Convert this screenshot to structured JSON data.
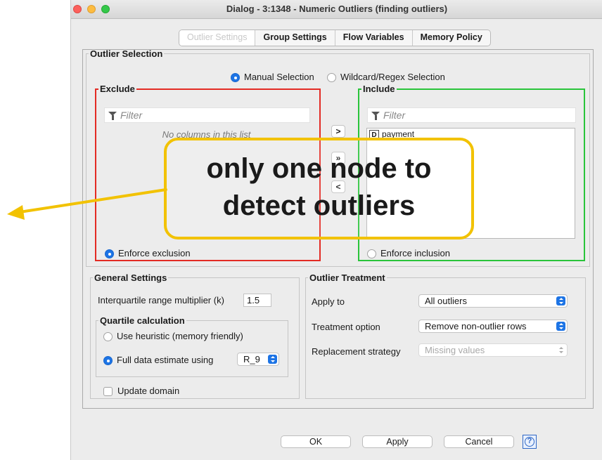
{
  "window": {
    "title": "Dialog - 3:1348 - Numeric Outliers (finding outliers)"
  },
  "tabs": [
    "Outlier Settings",
    "Group Settings",
    "Flow Variables",
    "Memory Policy"
  ],
  "outlier_selection": {
    "title": "Outlier Selection",
    "mode_manual": "Manual Selection",
    "mode_wildcard": "Wildcard/Regex Selection",
    "exclude": {
      "title": "Exclude",
      "filter_placeholder": "Filter",
      "empty_text": "No columns in this list",
      "enforce_label": "Enforce exclusion"
    },
    "include": {
      "title": "Include",
      "filter_placeholder": "Filter",
      "columns": [
        {
          "type": "D",
          "name": "payment"
        }
      ],
      "enforce_label": "Enforce inclusion"
    },
    "buttons": {
      "add": ">",
      "add_all": "»",
      "remove": "<"
    }
  },
  "general_settings": {
    "title": "General Settings",
    "iqr_label": "Interquartile range multiplier (k)",
    "iqr_value": "1.5",
    "quartile": {
      "title": "Quartile calculation",
      "heuristic_label": "Use heuristic (memory friendly)",
      "full_label": "Full data estimate using",
      "estimation_value": "R_9"
    },
    "update_domain_label": "Update domain"
  },
  "outlier_treatment": {
    "title": "Outlier Treatment",
    "apply_to_label": "Apply to",
    "apply_to_value": "All outliers",
    "treatment_label": "Treatment option",
    "treatment_value": "Remove non-outlier rows",
    "replacement_label": "Replacement strategy",
    "replacement_value": "Missing values"
  },
  "footer": {
    "ok": "OK",
    "apply": "Apply",
    "cancel": "Cancel",
    "help": "?"
  },
  "annotation": {
    "line1": "only one node to",
    "line2": "detect outliers"
  },
  "colors": {
    "annotation": "#f2c200",
    "exclude_border": "#e32b24",
    "include_border": "#29c43a",
    "accent": "#1d74e5"
  }
}
